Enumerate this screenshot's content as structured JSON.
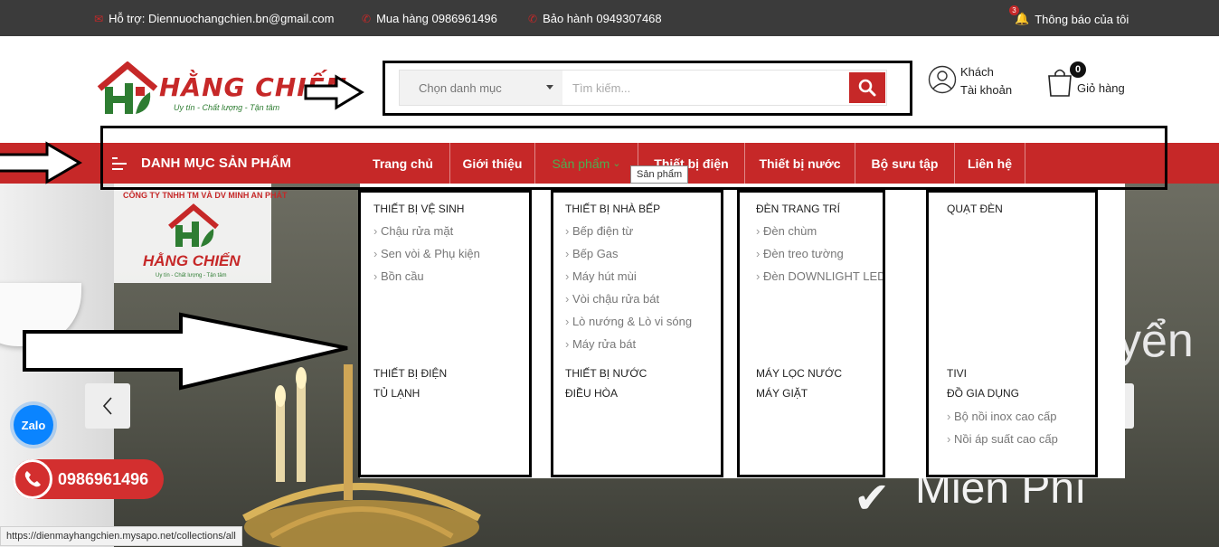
{
  "topbar": {
    "support": "Hỗ trợ: Diennuochangchien.bn@gmail.com",
    "buy": "Mua hàng 0986961496",
    "warranty": "Bảo hành 0949307468",
    "notification": "Thông báo của tôi",
    "notification_count": "3"
  },
  "logo": {
    "brand": "HẰNG CHIẾN",
    "slogan": "Uy tín - Chất lượng - Tận tâm"
  },
  "search": {
    "category_label": "Chọn danh mục",
    "placeholder": "Tìm kiếm..."
  },
  "account": {
    "line1": "Khách",
    "line2": "Tài khoản"
  },
  "cart": {
    "count": "0",
    "label": "Giỏ hàng"
  },
  "nav": {
    "category_button": "DANH MỤC SẢN PHẨM",
    "links": [
      {
        "label": "Trang chủ",
        "width": 104
      },
      {
        "label": "Giới thiệu",
        "width": 94
      },
      {
        "label": "Sản phẩm",
        "width": 114
      },
      {
        "label": "Thiết bị điện",
        "width": 118
      },
      {
        "label": "Thiết bị nước",
        "width": 122
      },
      {
        "label": "Bộ sưu tập",
        "width": 110
      },
      {
        "label": "Liên hệ",
        "width": 78
      }
    ],
    "active_index": 2,
    "tooltip": "Sản phẩm"
  },
  "megamenu": {
    "col1": {
      "title1": "THIẾT BỊ VỆ SINH",
      "items1": [
        "Chậu rửa mặt",
        "Sen vòi & Phụ kiện",
        "Bồn cầu"
      ],
      "title2": "THIẾT BỊ ĐIỆN",
      "title3": "TỦ LẠNH"
    },
    "col2": {
      "title1": "THIẾT BỊ NHÀ BẾP",
      "items1": [
        "Bếp điện từ",
        "Bếp Gas",
        "Máy hút mùi",
        "Vòi chậu rửa bát",
        "Lò nướng & Lò vi sóng",
        "Máy rửa bát"
      ],
      "title2": "THIẾT BỊ NƯỚC",
      "title3": "ĐIỀU HÒA"
    },
    "col3": {
      "title1": "ĐÈN TRANG TRÍ",
      "items1": [
        "Đèn chùm",
        "Đèn treo tường",
        "Đèn DOWNLIGHT LED"
      ],
      "title2": "MÁY LỌC NƯỚC",
      "title3": "MÁY GIẶT"
    },
    "col4": {
      "title1": "QUẠT ĐÈN",
      "title2": "TIVI",
      "title3": "ĐỒ GIA DỤNG",
      "items3": [
        "Bộ nồi inox cao cấp",
        "Nồi áp suất cao cấp"
      ]
    }
  },
  "banner": {
    "company": "CÔNG TY TNHH TM VÀ DV MINH AN PHÁT",
    "brand": "HẰNG CHIẾN",
    "slogan": "Uy tín - Chất lượng - Tận tâm",
    "text1": "yển",
    "text2": "Miễn Phí"
  },
  "floating": {
    "zalo": "Zalo",
    "hotline": "0986961496"
  },
  "statusbar": "https://dienmayhangchien.mysapo.net/collections/all"
}
